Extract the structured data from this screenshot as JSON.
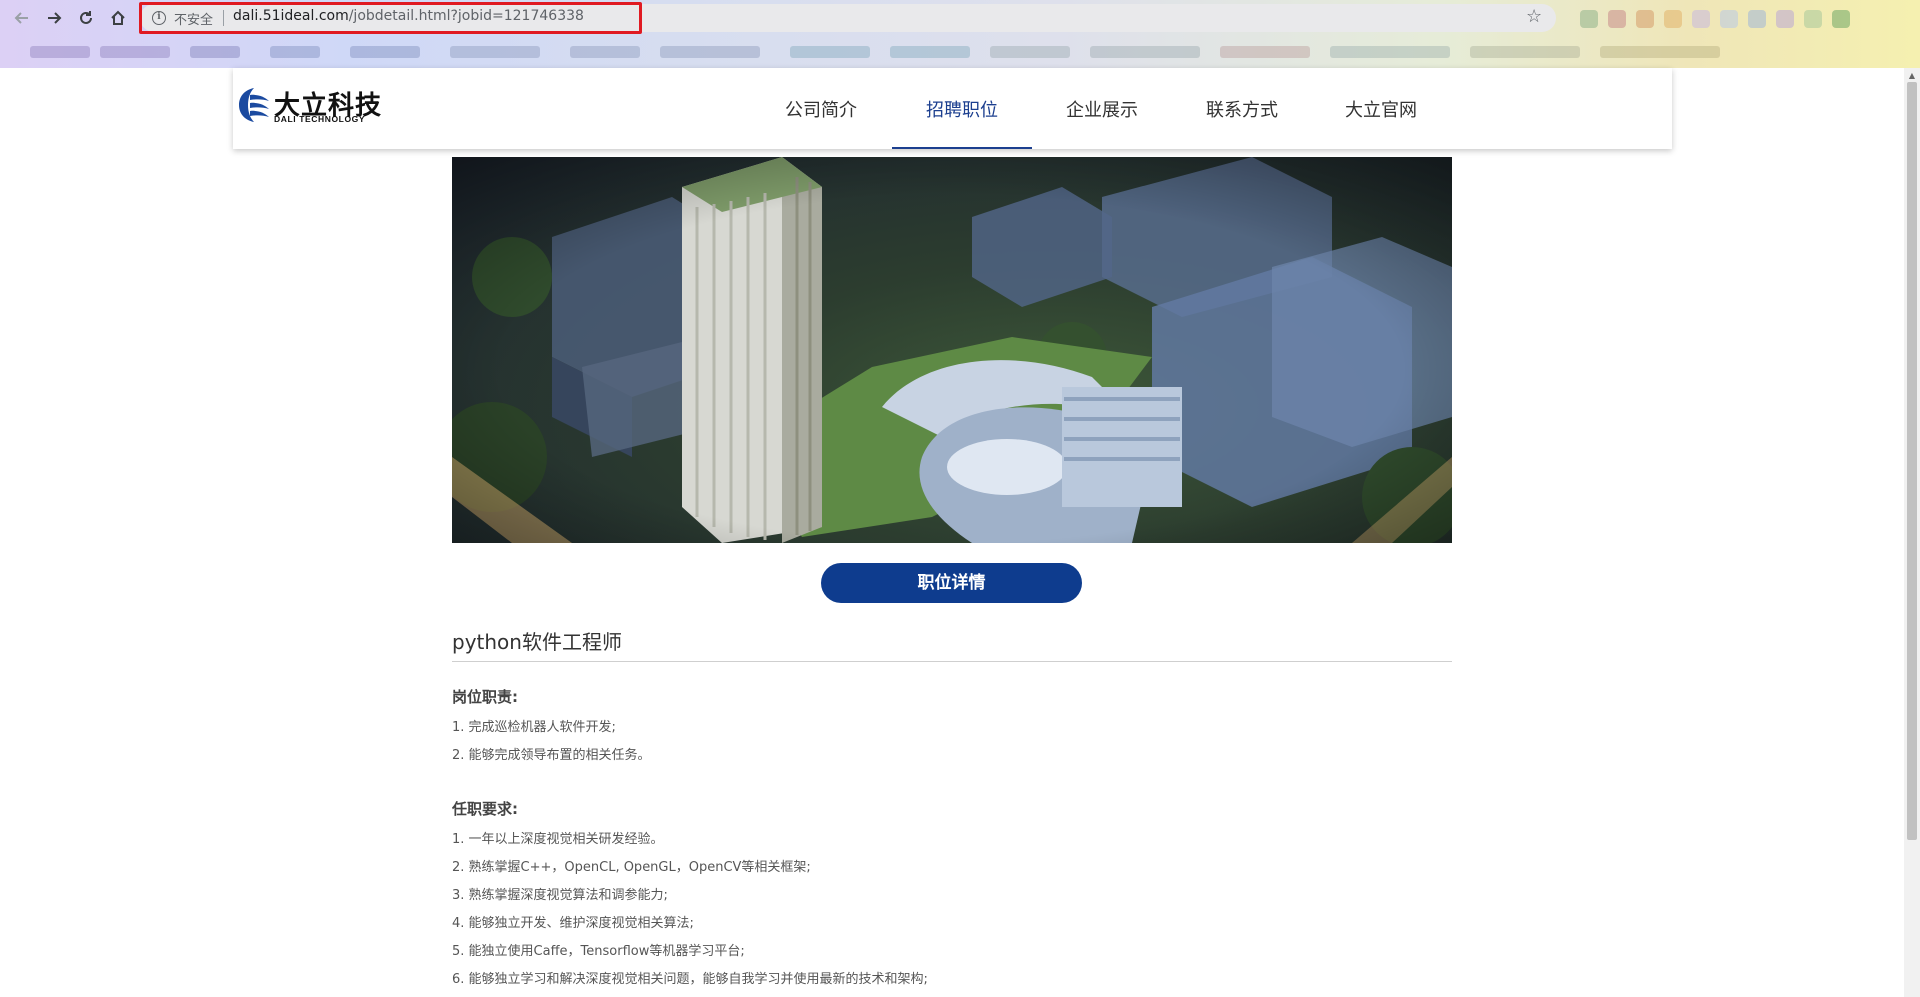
{
  "browser": {
    "insecure_label": "不安全",
    "url_host": "dali.51ideal.com",
    "url_path": "/jobdetail.html?jobid=121746338",
    "icons": [
      "back-icon",
      "forward-icon",
      "reload-icon",
      "home-icon",
      "info-icon",
      "star-icon"
    ]
  },
  "logo": {
    "cn": "大立科技",
    "en": "DALI TECHNOLOGY"
  },
  "nav": {
    "items": [
      "公司简介",
      "招聘职位",
      "企业展示",
      "联系方式",
      "大立官网"
    ],
    "active": "招聘职位",
    "accent_color": "#1c3f8f"
  },
  "detail_button": {
    "label": "职位详情",
    "color": "#0e3c8e"
  },
  "job": {
    "title": "python软件工程师",
    "duties_heading": "岗位职责:",
    "duties": [
      "1. 完成巡检机器人软件开发;",
      "2. 能够完成领导布置的相关任务。"
    ],
    "requirements_heading": "任职要求:",
    "requirements": [
      "1. 一年以上深度视觉相关研发经验。",
      "2. 熟练掌握C++，OpenCL, OpenGL，OpenCV等相关框架;",
      "3. 熟练掌握深度视觉算法和调参能力;",
      "4. 能够独立开发、维护深度视觉相关算法;",
      "5. 能独立使用Caffe，Tensorflow等机器学习平台;",
      "6. 能够独立学习和解决深度视觉相关问题，能够自我学习并使用最新的技术和架构;"
    ]
  }
}
